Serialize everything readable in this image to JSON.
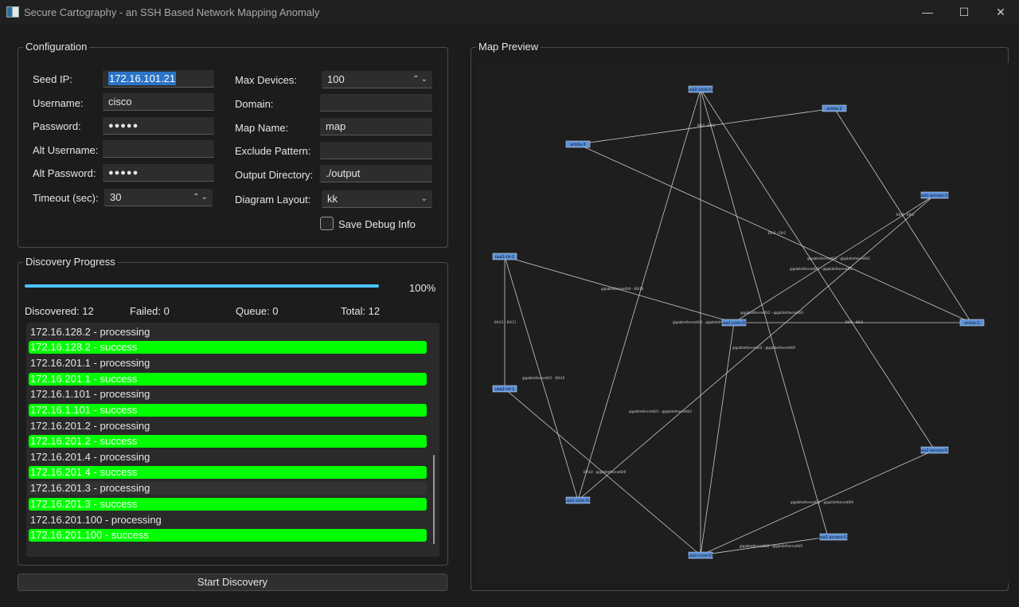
{
  "window": {
    "title": "Secure Cartography - an SSH Based Network Mapping Anomaly",
    "minimize_glyph": "—",
    "maximize_glyph": "☐",
    "close_glyph": "✕"
  },
  "configuration": {
    "title": "Configuration",
    "seed_ip_label": "Seed IP:",
    "seed_ip_value": "172.16.101.21",
    "username_label": "Username:",
    "username_value": "cisco",
    "password_label": "Password:",
    "password_value": "●●●●●",
    "alt_username_label": "Alt Username:",
    "alt_username_value": "",
    "alt_password_label": "Alt Password:",
    "alt_password_value": "●●●●●",
    "timeout_label": "Timeout (sec):",
    "timeout_value": "30",
    "max_devices_label": "Max Devices:",
    "max_devices_value": "100",
    "domain_label": "Domain:",
    "domain_value": "",
    "map_name_label": "Map Name:",
    "map_name_value": "map",
    "exclude_pattern_label": "Exclude Pattern:",
    "exclude_pattern_value": "",
    "output_directory_label": "Output Directory:",
    "output_directory_value": "./output",
    "diagram_layout_label": "Diagram Layout:",
    "diagram_layout_value": "kk",
    "save_debug_label": "Save Debug Info",
    "save_debug_checked": false,
    "spin_glyph": "⌃⌄",
    "dropdown_glyph": "⌄"
  },
  "progress": {
    "title": "Discovery Progress",
    "percent": 100,
    "percent_label": "100%",
    "discovered_label": "Discovered: 12",
    "failed_label": "Failed: 0",
    "queue_label": "Queue: 0",
    "total_label": "Total: 12",
    "log": [
      {
        "text": "172.16.128.2 - processing",
        "status": "processing"
      },
      {
        "text": "172.16.128.2 - success",
        "status": "success"
      },
      {
        "text": "172.16.201.1 - processing",
        "status": "processing"
      },
      {
        "text": "172.16.201.1 - success",
        "status": "success"
      },
      {
        "text": "172.16.1.101 - processing",
        "status": "processing"
      },
      {
        "text": "172.16.1.101 - success",
        "status": "success"
      },
      {
        "text": "172.16.201.2 - processing",
        "status": "processing"
      },
      {
        "text": "172.16.201.2 - success",
        "status": "success"
      },
      {
        "text": "172.16.201.4 - processing",
        "status": "processing"
      },
      {
        "text": "172.16.201.4 - success",
        "status": "success"
      },
      {
        "text": "172.16.201.3 - processing",
        "status": "processing"
      },
      {
        "text": "172.16.201.3 - success",
        "status": "success"
      },
      {
        "text": "172.16.201.100 - processing",
        "status": "processing"
      },
      {
        "text": "172.16.201.100 - success",
        "status": "success"
      }
    ]
  },
  "start_button_label": "Start Discovery",
  "map": {
    "title": "Map Preview",
    "nodes": [
      {
        "id": "usa2-core-02",
        "label": "usa2-core-02"
      },
      {
        "id": "arista-2",
        "label": "arista-2"
      },
      {
        "id": "arista-3",
        "label": "arista-3"
      },
      {
        "id": "usa1-access-02",
        "label": "usa1-access-02"
      },
      {
        "id": "usa1-rtr-1",
        "label": "usa1-rtr-1"
      },
      {
        "id": "usa2-core-01",
        "label": "usa2-core-01"
      },
      {
        "id": "arista-1",
        "label": "arista-1"
      },
      {
        "id": "usa2-rtr-1",
        "label": "usa2-rtr-1"
      },
      {
        "id": "usa2-access-01",
        "label": "usa2-access-01"
      },
      {
        "id": "usa1-core-02",
        "label": "usa1-core-02"
      },
      {
        "id": "usa2-access-02",
        "label": "usa2-access-02"
      },
      {
        "id": "usa1-core-01",
        "label": "usa1-core-01"
      }
    ],
    "edge_labels": [
      "Eth2 - Eth1",
      "Eth3 - Eth1",
      "Eth2 - Eth1",
      "gigabitethernet0/1 - gigabitethernet0/2",
      "gigabitethernet0/1 - gigabitethernet0/1",
      "gigabitethernet0/0 - Eth10",
      "gigabitethernet0/2 - gigabitethernet0/0",
      "gigabitethernet0/1 - gigabitethernet0/1",
      "Eth1 - Eth2",
      "Eth11 - Eth11",
      "gigabitethernet0/2 - gigabitethernet0/9",
      "gigabitethernet0/1 - Eth10",
      "gigabitethernet0/1 - gigabitethernet0/2",
      "Eth10 - gigabitethernet0/0",
      "gigabitethernet0/2 - gigabitethernet0/9",
      "gigabitethernet0/2 - gigabitethernet0/9"
    ]
  },
  "colors": {
    "progress": "#4cc2ff",
    "success": "#00ff00",
    "node": "#5b8fd6",
    "selection": "#2b74c7"
  }
}
